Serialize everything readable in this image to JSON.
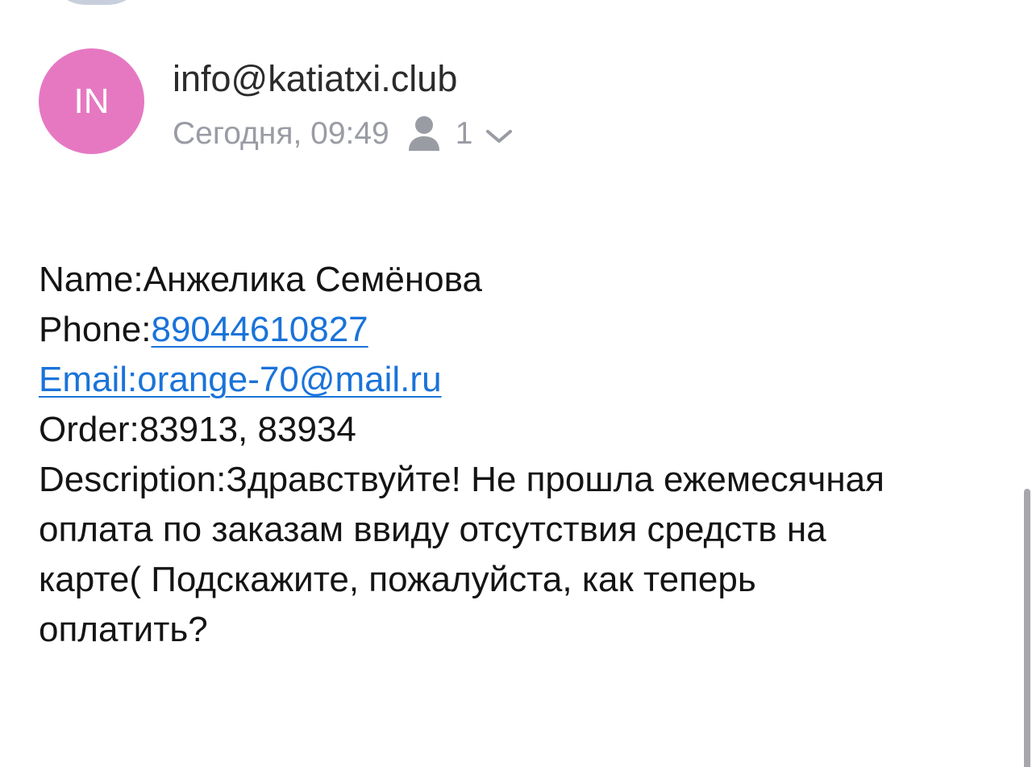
{
  "sender": {
    "avatar_initials": "IN",
    "email": "info@katiatxi.club",
    "date": "Сегодня, 09:49",
    "recipients_count": "1"
  },
  "message": {
    "name_label": "Name:",
    "name_value": "Анжелика Семёнова",
    "phone_label": "Phone:",
    "phone_value": "89044610827",
    "email_link": "Email:orange-70@mail.ru",
    "order_label": "Order:",
    "order_value": "83913, 83934",
    "description_label": "Description:",
    "description_lines": [
      "Здравствуйте! Не прошла ежемесячная",
      "оплата по заказам ввиду отсутствия средств на",
      "карте( Подскажите, пожалуйста, как теперь",
      "оплатить?"
    ]
  },
  "colors": {
    "avatar_bg": "#e678c2",
    "link": "#1a73d9",
    "meta_text": "#9a9ca4"
  },
  "icons": {
    "recipients": "person-icon",
    "expand": "chevron-down-icon"
  }
}
